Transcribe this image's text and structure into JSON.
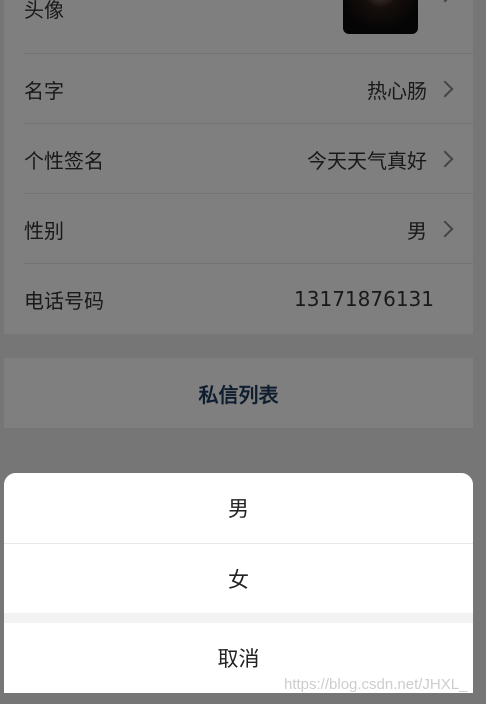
{
  "profile": {
    "avatar_label": "头像",
    "name_label": "名字",
    "name_value": "热心肠",
    "signature_label": "个性签名",
    "signature_value": "今天天气真好",
    "gender_label": "性别",
    "gender_value": "男",
    "phone_label": "电话号码",
    "phone_value": "13171876131"
  },
  "private_messages": {
    "label": "私信列表"
  },
  "action_sheet": {
    "options": [
      "男",
      "女"
    ],
    "cancel_label": "取消"
  },
  "watermark": "https://blog.csdn.net/JHXL_"
}
